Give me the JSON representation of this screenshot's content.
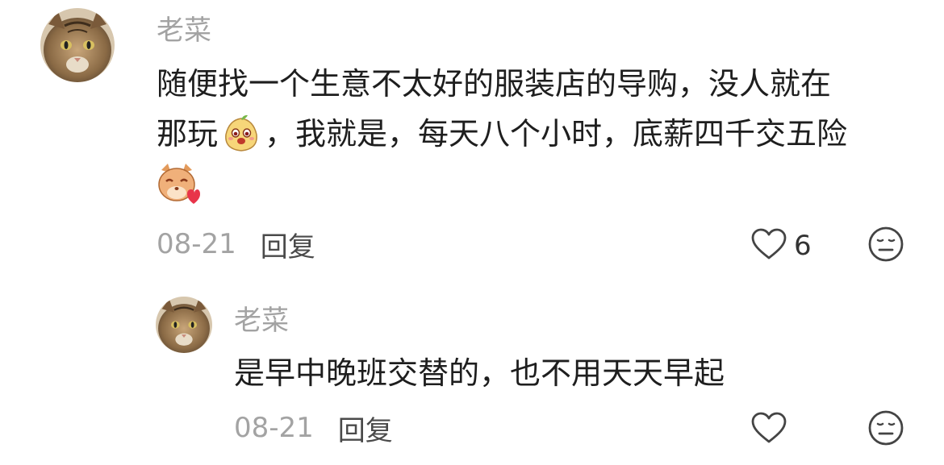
{
  "comments": [
    {
      "author": "老菜",
      "lines": [
        "随便找一个生意不太好的服装店的导购，没人就在",
        "那玩",
        "，我就是，每天八个小时，底薪四千交五险"
      ],
      "date": "08-21",
      "reply_label": "回复",
      "like_count": "6",
      "icons": [
        "cat-avatar",
        "heart-outline-icon",
        "neutral-face-icon",
        "pear-emoji-icon",
        "cat-heart-emoji-icon"
      ]
    },
    {
      "author": "老菜",
      "lines": [
        "是早中晚班交替的，也不用天天早起"
      ],
      "date": "08-21",
      "reply_label": "回复",
      "icons": [
        "cat-avatar",
        "heart-outline-icon",
        "neutral-face-icon"
      ]
    }
  ]
}
